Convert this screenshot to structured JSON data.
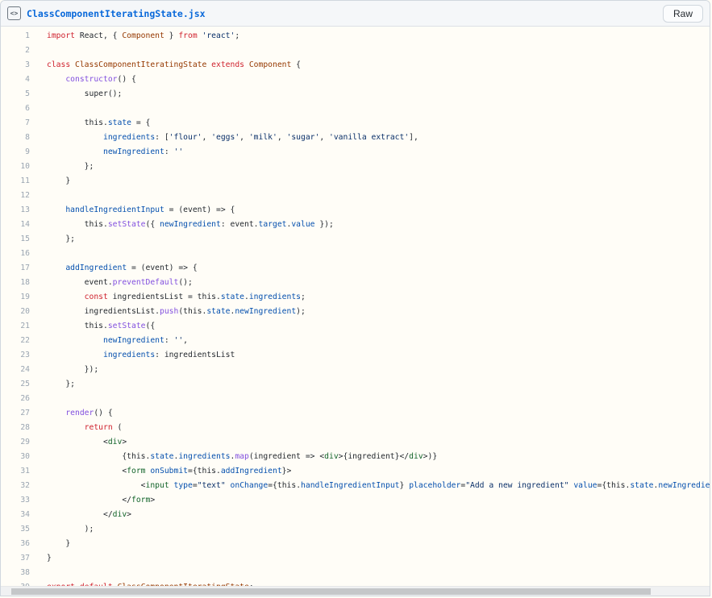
{
  "header": {
    "filename": "ClassComponentIteratingState.jsx",
    "raw_button_label": "Raw",
    "file_icon_glyph": "<>"
  },
  "theme": {
    "filename_color": "#0969da",
    "header_bg": "#f5f7f9",
    "code_bg": "#fffdf7",
    "border": "#d0d7de",
    "line_number_color": "#9aa5b1",
    "scrollbar_thumb": "#c5c7c9"
  },
  "code": {
    "language": "jsx",
    "colors": {
      "k": "#cf222e",
      "e": "#953800",
      "f": "#8250df",
      "v": "#0550ae",
      "s": "#0a3069",
      "t": "#116329",
      "p": "#24292f"
    },
    "lines": [
      {
        "n": 1,
        "t": [
          [
            "import",
            "k"
          ],
          [
            " React, { ",
            "p"
          ],
          [
            "Component",
            "e"
          ],
          [
            " } ",
            "p"
          ],
          [
            "from",
            "k"
          ],
          [
            " ",
            "p"
          ],
          [
            "'react'",
            "s"
          ],
          [
            ";",
            "p"
          ]
        ]
      },
      {
        "n": 2,
        "t": []
      },
      {
        "n": 3,
        "t": [
          [
            "class",
            "k"
          ],
          [
            " ",
            "p"
          ],
          [
            "ClassComponentIteratingState",
            "e"
          ],
          [
            " ",
            "p"
          ],
          [
            "extends",
            "k"
          ],
          [
            " ",
            "p"
          ],
          [
            "Component",
            "e"
          ],
          [
            " {",
            "p"
          ]
        ]
      },
      {
        "n": 4,
        "t": [
          [
            "    ",
            "p"
          ],
          [
            "constructor",
            "f"
          ],
          [
            "() {",
            "p"
          ]
        ]
      },
      {
        "n": 5,
        "t": [
          [
            "        super();",
            "p"
          ]
        ]
      },
      {
        "n": 6,
        "t": []
      },
      {
        "n": 7,
        "t": [
          [
            "        this.",
            "p"
          ],
          [
            "state",
            "v"
          ],
          [
            " = {",
            "p"
          ]
        ]
      },
      {
        "n": 8,
        "t": [
          [
            "            ",
            "p"
          ],
          [
            "ingredients",
            "v"
          ],
          [
            ": [",
            "p"
          ],
          [
            "'flour'",
            "s"
          ],
          [
            ", ",
            "p"
          ],
          [
            "'eggs'",
            "s"
          ],
          [
            ", ",
            "p"
          ],
          [
            "'milk'",
            "s"
          ],
          [
            ", ",
            "p"
          ],
          [
            "'sugar'",
            "s"
          ],
          [
            ", ",
            "p"
          ],
          [
            "'vanilla extract'",
            "s"
          ],
          [
            "],",
            "p"
          ]
        ]
      },
      {
        "n": 9,
        "t": [
          [
            "            ",
            "p"
          ],
          [
            "newIngredient",
            "v"
          ],
          [
            ": ",
            "p"
          ],
          [
            "''",
            "s"
          ]
        ]
      },
      {
        "n": 10,
        "t": [
          [
            "        };",
            "p"
          ]
        ]
      },
      {
        "n": 11,
        "t": [
          [
            "    }",
            "p"
          ]
        ]
      },
      {
        "n": 12,
        "t": []
      },
      {
        "n": 13,
        "t": [
          [
            "    ",
            "p"
          ],
          [
            "handleIngredientInput",
            "v"
          ],
          [
            " = (event) => {",
            "p"
          ]
        ]
      },
      {
        "n": 14,
        "t": [
          [
            "        this.",
            "p"
          ],
          [
            "setState",
            "f"
          ],
          [
            "({ ",
            "p"
          ],
          [
            "newIngredient",
            "v"
          ],
          [
            ": event.",
            "p"
          ],
          [
            "target",
            "v"
          ],
          [
            ".",
            "p"
          ],
          [
            "value",
            "v"
          ],
          [
            " });",
            "p"
          ]
        ]
      },
      {
        "n": 15,
        "t": [
          [
            "    };",
            "p"
          ]
        ]
      },
      {
        "n": 16,
        "t": []
      },
      {
        "n": 17,
        "t": [
          [
            "    ",
            "p"
          ],
          [
            "addIngredient",
            "v"
          ],
          [
            " = (event) => {",
            "p"
          ]
        ]
      },
      {
        "n": 18,
        "t": [
          [
            "        event.",
            "p"
          ],
          [
            "preventDefault",
            "f"
          ],
          [
            "();",
            "p"
          ]
        ]
      },
      {
        "n": 19,
        "t": [
          [
            "        ",
            "p"
          ],
          [
            "const",
            "k"
          ],
          [
            " ingredientsList = this.",
            "p"
          ],
          [
            "state",
            "v"
          ],
          [
            ".",
            "p"
          ],
          [
            "ingredients",
            "v"
          ],
          [
            ";",
            "p"
          ]
        ]
      },
      {
        "n": 20,
        "t": [
          [
            "        ingredientsList.",
            "p"
          ],
          [
            "push",
            "f"
          ],
          [
            "(this.",
            "p"
          ],
          [
            "state",
            "v"
          ],
          [
            ".",
            "p"
          ],
          [
            "newIngredient",
            "v"
          ],
          [
            ");",
            "p"
          ]
        ]
      },
      {
        "n": 21,
        "t": [
          [
            "        this.",
            "p"
          ],
          [
            "setState",
            "f"
          ],
          [
            "({",
            "p"
          ]
        ]
      },
      {
        "n": 22,
        "t": [
          [
            "            ",
            "p"
          ],
          [
            "newIngredient",
            "v"
          ],
          [
            ": ",
            "p"
          ],
          [
            "''",
            "s"
          ],
          [
            ",",
            "p"
          ]
        ]
      },
      {
        "n": 23,
        "t": [
          [
            "            ",
            "p"
          ],
          [
            "ingredients",
            "v"
          ],
          [
            ": ingredientsList",
            "p"
          ]
        ]
      },
      {
        "n": 24,
        "t": [
          [
            "        });",
            "p"
          ]
        ]
      },
      {
        "n": 25,
        "t": [
          [
            "    };",
            "p"
          ]
        ]
      },
      {
        "n": 26,
        "t": []
      },
      {
        "n": 27,
        "t": [
          [
            "    ",
            "p"
          ],
          [
            "render",
            "f"
          ],
          [
            "() {",
            "p"
          ]
        ]
      },
      {
        "n": 28,
        "t": [
          [
            "        ",
            "p"
          ],
          [
            "return",
            "k"
          ],
          [
            " (",
            "p"
          ]
        ]
      },
      {
        "n": 29,
        "t": [
          [
            "            <",
            "p"
          ],
          [
            "div",
            "t"
          ],
          [
            ">",
            "p"
          ]
        ]
      },
      {
        "n": 30,
        "t": [
          [
            "                {this.",
            "p"
          ],
          [
            "state",
            "v"
          ],
          [
            ".",
            "p"
          ],
          [
            "ingredients",
            "v"
          ],
          [
            ".",
            "p"
          ],
          [
            "map",
            "f"
          ],
          [
            "(ingredient => <",
            "p"
          ],
          [
            "div",
            "t"
          ],
          [
            ">{ingredient}</",
            "p"
          ],
          [
            "div",
            "t"
          ],
          [
            ">)}",
            "p"
          ]
        ]
      },
      {
        "n": 31,
        "t": [
          [
            "                <",
            "p"
          ],
          [
            "form",
            "t"
          ],
          [
            " ",
            "p"
          ],
          [
            "onSubmit",
            "v"
          ],
          [
            "={this.",
            "p"
          ],
          [
            "addIngredient",
            "v"
          ],
          [
            "}>",
            "p"
          ]
        ]
      },
      {
        "n": 32,
        "t": [
          [
            "                    <",
            "p"
          ],
          [
            "input",
            "t"
          ],
          [
            " ",
            "p"
          ],
          [
            "type",
            "v"
          ],
          [
            "=",
            "p"
          ],
          [
            "\"text\"",
            "s"
          ],
          [
            " ",
            "p"
          ],
          [
            "onChange",
            "v"
          ],
          [
            "={this.",
            "p"
          ],
          [
            "handleIngredientInput",
            "v"
          ],
          [
            "} ",
            "p"
          ],
          [
            "placeholder",
            "v"
          ],
          [
            "=",
            "p"
          ],
          [
            "\"Add a new ingredient\"",
            "s"
          ],
          [
            " ",
            "p"
          ],
          [
            "value",
            "v"
          ],
          [
            "={this.",
            "p"
          ],
          [
            "state",
            "v"
          ],
          [
            ".",
            "p"
          ],
          [
            "newIngredient",
            "v"
          ],
          [
            "} />",
            "p"
          ]
        ]
      },
      {
        "n": 33,
        "t": [
          [
            "                </",
            "p"
          ],
          [
            "form",
            "t"
          ],
          [
            ">",
            "p"
          ]
        ]
      },
      {
        "n": 34,
        "t": [
          [
            "            </",
            "p"
          ],
          [
            "div",
            "t"
          ],
          [
            ">",
            "p"
          ]
        ]
      },
      {
        "n": 35,
        "t": [
          [
            "        );",
            "p"
          ]
        ]
      },
      {
        "n": 36,
        "t": [
          [
            "    }",
            "p"
          ]
        ]
      },
      {
        "n": 37,
        "t": [
          [
            "}",
            "p"
          ]
        ]
      },
      {
        "n": 38,
        "t": []
      },
      {
        "n": 39,
        "t": [
          [
            "export",
            "k"
          ],
          [
            " ",
            "p"
          ],
          [
            "default",
            "k"
          ],
          [
            " ",
            "p"
          ],
          [
            "ClassComponentIteratingState",
            "e"
          ],
          [
            ";",
            "p"
          ]
        ]
      }
    ]
  }
}
